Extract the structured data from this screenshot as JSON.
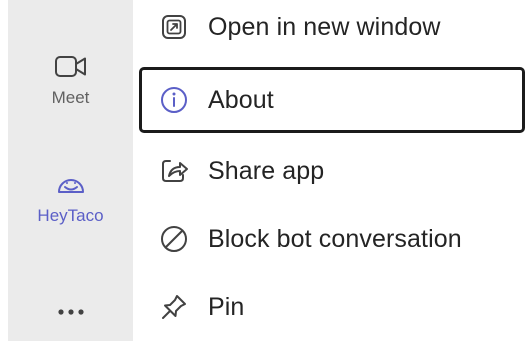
{
  "rail": {
    "items": [
      {
        "label": "Meet",
        "icon": "video-camera-icon",
        "active": false
      },
      {
        "label": "HeyTaco",
        "icon": "heytaco-app-icon",
        "active": true
      }
    ],
    "more_icon": "more-horizontal-icon"
  },
  "menu": {
    "items": [
      {
        "label": "Open in new window",
        "icon": "open-in-new-window-icon"
      },
      {
        "label": "About",
        "icon": "info-icon",
        "focused": true
      },
      {
        "label": "Share app",
        "icon": "share-icon"
      },
      {
        "label": "Block bot conversation",
        "icon": "block-icon"
      },
      {
        "label": "Pin",
        "icon": "pin-icon"
      }
    ]
  },
  "colors": {
    "accent": "#5b5fc7",
    "rail_background": "#ebebeb",
    "text": "#242424",
    "focus_border": "#1b1b1b"
  }
}
